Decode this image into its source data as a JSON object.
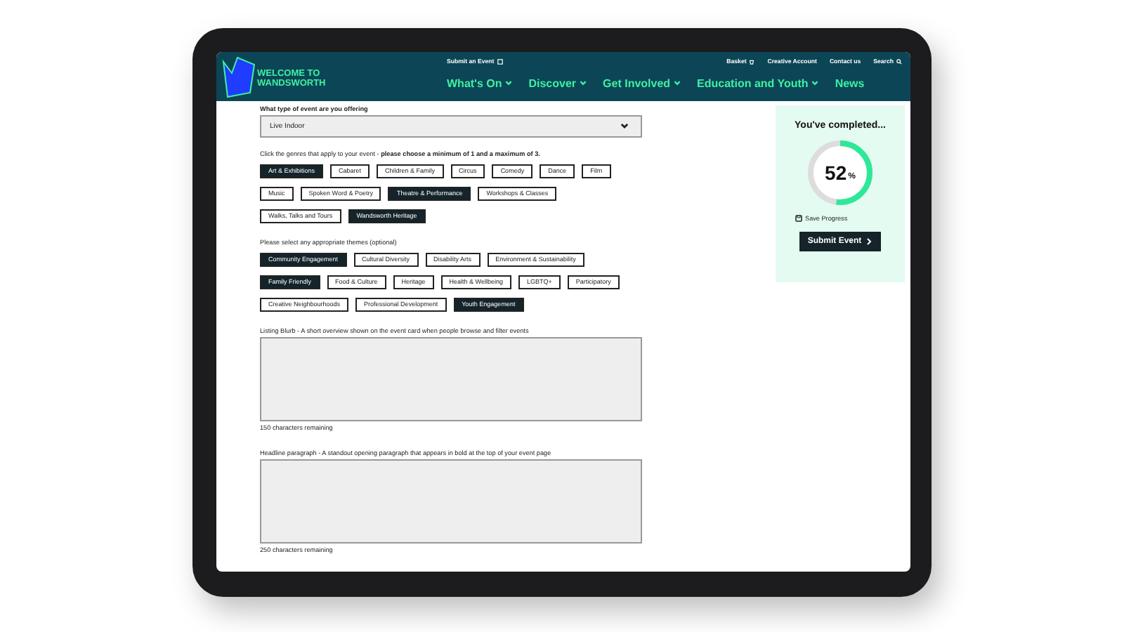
{
  "header": {
    "logo": "WELCOME TO WANDSWORTH",
    "utility_links": [
      {
        "label": "Submit an Event"
      },
      {
        "label": "Basket"
      },
      {
        "label": "Creative Account"
      },
      {
        "label": "Contact us"
      },
      {
        "label": "Search"
      }
    ],
    "nav": [
      {
        "label": "What's On",
        "caret": true
      },
      {
        "label": "Discover",
        "caret": true
      },
      {
        "label": "Get Involved",
        "caret": true
      },
      {
        "label": "Education and Youth",
        "caret": true
      },
      {
        "label": "News",
        "caret": false
      }
    ]
  },
  "form": {
    "event_type": {
      "label": "What type of event are you offering",
      "value": "Live Indoor"
    },
    "genres_instruction": "Click the genres that apply to your event - **please choose a minimum of 1 and a maximum of 3.**",
    "genres": [
      {
        "label": "Art & Exhibitions",
        "selected": true
      },
      {
        "label": "Cabaret",
        "selected": false
      },
      {
        "label": "Children & Family",
        "selected": false
      },
      {
        "label": "Circus",
        "selected": false
      },
      {
        "label": "Comedy",
        "selected": false
      },
      {
        "label": "Dance",
        "selected": false
      },
      {
        "label": "Film",
        "selected": false
      },
      {
        "label": "Music",
        "selected": false
      },
      {
        "label": "Spoken Word & Poetry",
        "selected": false
      },
      {
        "label": "Theatre & Performance",
        "selected": true
      },
      {
        "label": "Workshops & Classes",
        "selected": false
      },
      {
        "label": "Walks, Talks and Tours",
        "selected": false
      },
      {
        "label": "Wandsworth Heritage",
        "selected": true
      }
    ],
    "themes_label": "Please select any appropriate themes (optional)",
    "themes": [
      {
        "label": "Community Engagement",
        "selected": true
      },
      {
        "label": "Cultural Diversity",
        "selected": false
      },
      {
        "label": "Disability Arts",
        "selected": false
      },
      {
        "label": "Environment & Sustainability",
        "selected": false
      },
      {
        "label": "Family Friendly",
        "selected": true
      },
      {
        "label": "Food & Culture",
        "selected": false
      },
      {
        "label": "Heritage",
        "selected": false
      },
      {
        "label": "Health & Wellbeing",
        "selected": false
      },
      {
        "label": "LGBTQ+",
        "selected": false
      },
      {
        "label": "Participatory",
        "selected": false
      },
      {
        "label": "Creative Neighbourhoods",
        "selected": false
      },
      {
        "label": "Professional Development",
        "selected": false
      },
      {
        "label": "Youth Engagement",
        "selected": true
      }
    ],
    "text_areas": [
      {
        "label": "Listing Blurb - A short overview shown on the event card when people browse and filter events",
        "remaining": "150 characters remaining"
      },
      {
        "label": "Headline paragraph - A standout opening paragraph that appears in bold at the top of your event page",
        "remaining": "250 characters remaining"
      }
    ]
  },
  "progress": {
    "title": "You've completed...",
    "percent": "52",
    "unit": "%",
    "level": 0.52,
    "save": "Save Progress",
    "submit": "Submit Event"
  }
}
